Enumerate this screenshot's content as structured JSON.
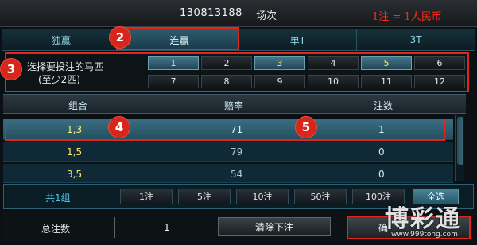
{
  "header": {
    "race_id": "130813188",
    "race_label": "场次",
    "price_note": "1注 = 1人民币"
  },
  "tabs": [
    {
      "label": "独赢",
      "active": false
    },
    {
      "label": "连赢",
      "active": true
    },
    {
      "label": "单T",
      "active": false
    },
    {
      "label": "3T",
      "active": false
    }
  ],
  "selector": {
    "label_line1": "选择要投注的马匹",
    "label_line2": "(至少2匹)",
    "horses": [
      {
        "n": "1",
        "selected": true
      },
      {
        "n": "2",
        "selected": false
      },
      {
        "n": "3",
        "selected": true
      },
      {
        "n": "4",
        "selected": false
      },
      {
        "n": "5",
        "selected": true
      },
      {
        "n": "6",
        "selected": false
      },
      {
        "n": "7",
        "selected": false
      },
      {
        "n": "8",
        "selected": false
      },
      {
        "n": "9",
        "selected": false
      },
      {
        "n": "10",
        "selected": false
      },
      {
        "n": "11",
        "selected": false
      },
      {
        "n": "12",
        "selected": false
      }
    ]
  },
  "table": {
    "headers": [
      "组合",
      "赔率",
      "注数"
    ],
    "rows": [
      {
        "combo": "1,3",
        "odds": "71",
        "bets": "1"
      },
      {
        "combo": "1,5",
        "odds": "79",
        "bets": "0"
      },
      {
        "combo": "3,5",
        "odds": "54",
        "bets": "0"
      }
    ]
  },
  "amounts": {
    "group_count": "共1组",
    "buttons": [
      "1注",
      "5注",
      "10注",
      "50注",
      "100注"
    ],
    "select_all": "全选"
  },
  "bottom": {
    "total_label": "总注数",
    "total_value": "1",
    "clear_label": "清除下注",
    "confirm_label": "确"
  },
  "badges": [
    "2",
    "3",
    "4",
    "5"
  ],
  "watermark": {
    "chars": "博彩通",
    "url": "www.999tong.com"
  },
  "colors": {
    "accent_red": "#e3261b",
    "selected_yellow": "#ffe36a",
    "tab_text": "#8fd4e3"
  }
}
